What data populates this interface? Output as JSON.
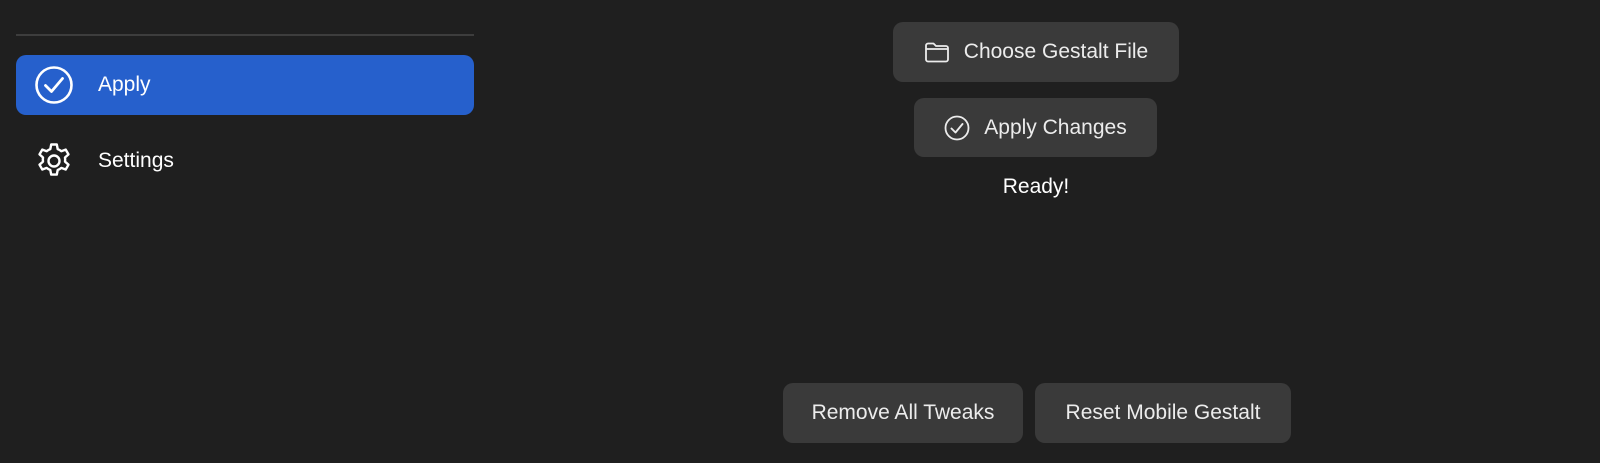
{
  "sidebar": {
    "items": [
      {
        "label": "Apply",
        "icon": "checkmark-circle-icon",
        "active": true
      },
      {
        "label": "Settings",
        "icon": "gear-icon",
        "active": false
      }
    ]
  },
  "main": {
    "choose_file_label": "Choose Gestalt File",
    "choose_file_icon": "folder-icon",
    "apply_changes_label": "Apply Changes",
    "apply_changes_icon": "checkmark-circle-icon",
    "status_text": "Ready!",
    "remove_all_tweaks_label": "Remove All Tweaks",
    "reset_mobile_gestalt_label": "Reset Mobile Gestalt"
  },
  "colors": {
    "background": "#1f1f1f",
    "accent": "#2660cc",
    "button": "#3a3a3a",
    "divider": "#3d3d3d"
  }
}
